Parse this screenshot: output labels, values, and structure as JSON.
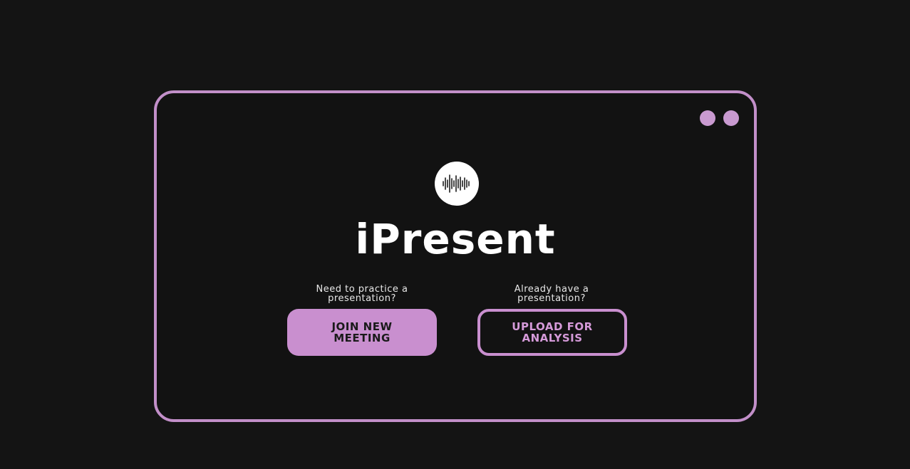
{
  "app": {
    "title": "iPresent"
  },
  "colors": {
    "accent": "#c98fcf",
    "background": "#141414",
    "window_background": "#121212",
    "text": "#ffffff"
  },
  "window_controls": [
    {
      "icon": "dot-icon"
    },
    {
      "icon": "dot-icon"
    }
  ],
  "logo": {
    "icon": "soundwave-icon"
  },
  "actions": {
    "practice": {
      "prompt": "Need to practice a presentation?",
      "button_label": "JOIN NEW MEETING"
    },
    "upload": {
      "prompt": "Already have a presentation?",
      "button_label": "UPLOAD FOR ANALYSIS"
    }
  }
}
